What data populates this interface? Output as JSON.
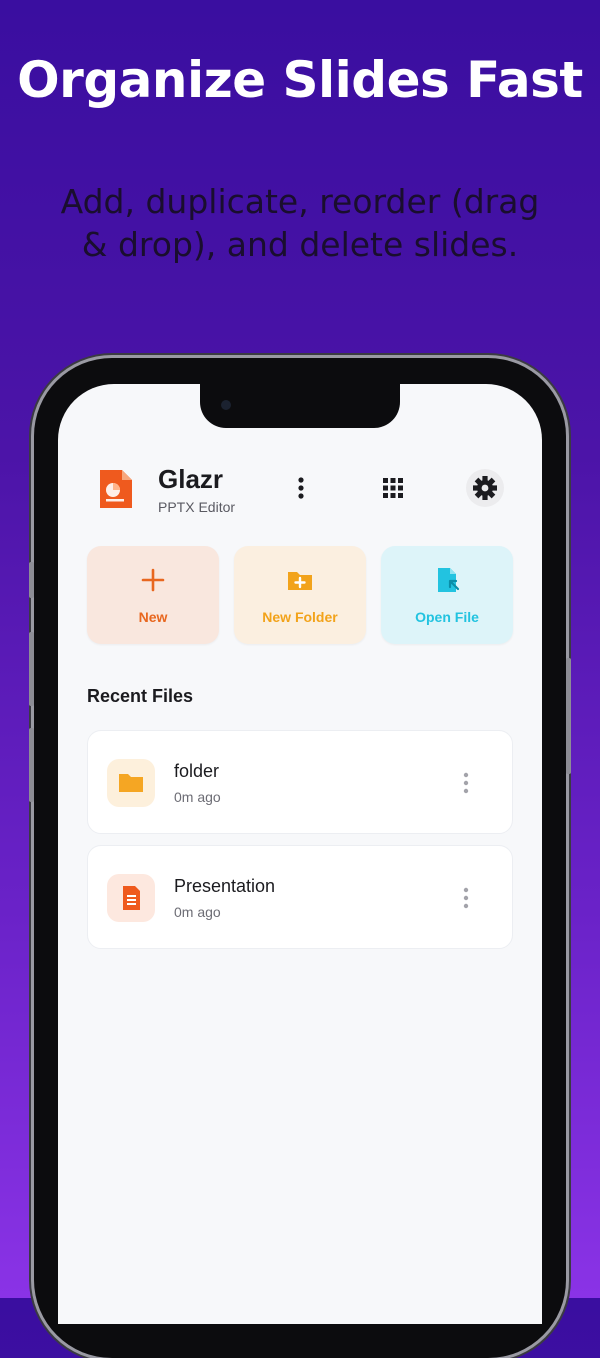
{
  "headline": "Organize Slides Fast",
  "subline": "Add, duplicate, reorder (drag & drop), and delete slides.",
  "app": {
    "title": "Glazr",
    "subtitle": "PPTX Editor",
    "icons": [
      "kebab-menu-icon",
      "grid-icon",
      "gear-icon"
    ]
  },
  "actions": [
    {
      "label": "New",
      "icon": "plus-icon",
      "color": "#e8671f",
      "bg": "#f9e7de"
    },
    {
      "label": "New Folder",
      "icon": "folder-plus-icon",
      "color": "#f2a31b",
      "bg": "#fbefe0"
    },
    {
      "label": "Open File",
      "icon": "open-file-icon",
      "color": "#22c3e0",
      "bg": "#ddf4f9"
    }
  ],
  "recent": {
    "heading": "Recent Files",
    "items": [
      {
        "name": "folder",
        "time": "0m ago",
        "icon": "folder-icon"
      },
      {
        "name": "Presentation",
        "time": "0m ago",
        "icon": "document-icon"
      }
    ]
  }
}
